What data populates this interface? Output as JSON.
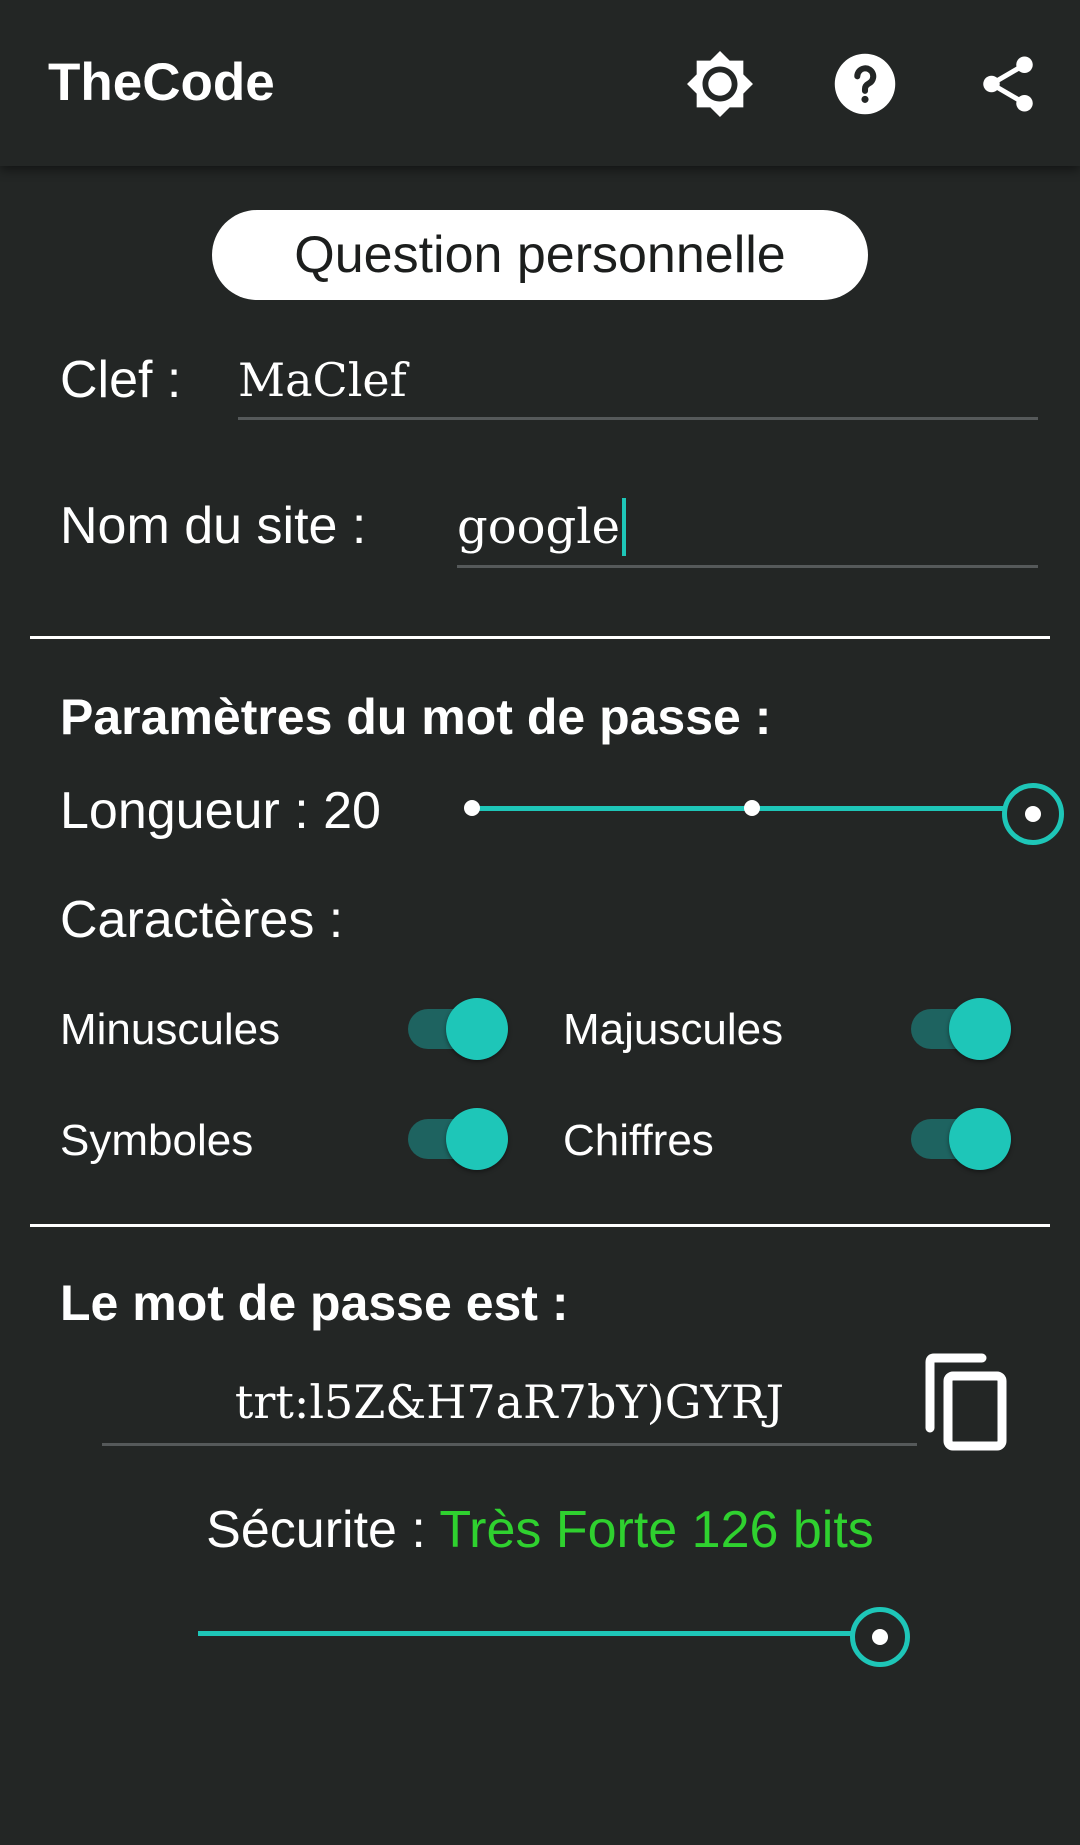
{
  "app": {
    "title": "TheCode"
  },
  "toolbar": {
    "icons": [
      "brightness-icon",
      "help-icon",
      "share-icon"
    ]
  },
  "question_button": {
    "label": "Question personnelle"
  },
  "key": {
    "label": "Clef :",
    "value": "MaClef"
  },
  "site": {
    "label": "Nom du site :",
    "value": "google"
  },
  "params": {
    "heading": "Paramètres du mot de passe :",
    "length_label": "Longueur : 20",
    "length_value": 20,
    "characters_label": "Caractères :",
    "toggles": [
      {
        "label": "Minuscules",
        "on": true
      },
      {
        "label": "Majuscules",
        "on": true
      },
      {
        "label": "Symboles",
        "on": true
      },
      {
        "label": "Chiffres",
        "on": true
      }
    ]
  },
  "result": {
    "heading": "Le mot de passe est :",
    "password": "trt:l5Z&H7aR7bY)GYRJ",
    "security_label": "Sécurite : ",
    "security_value": "Très Forte 126 bits",
    "security_level": 1.0
  },
  "colors": {
    "accent": "#1ec6b8",
    "background": "#232625",
    "strength": "#2fd12f"
  }
}
